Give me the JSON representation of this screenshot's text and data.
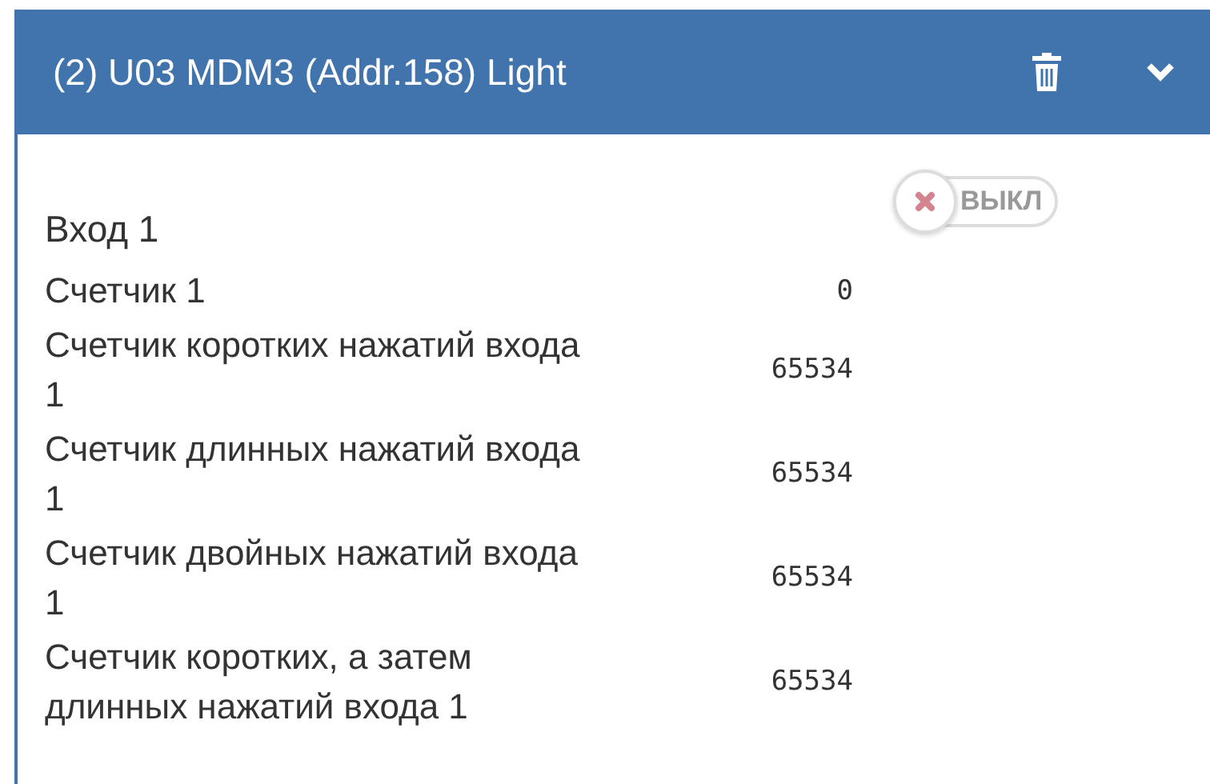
{
  "header": {
    "title": "(2) U03 MDM3 (Addr.158) Light"
  },
  "input": {
    "label": "Вход 1",
    "toggle": {
      "on": false,
      "label": "ВЫКЛ"
    }
  },
  "counters": [
    {
      "label": "Счетчик 1",
      "value": "0"
    },
    {
      "label": "Счетчик коротких нажатий входа 1",
      "value": "65534"
    },
    {
      "label": "Счетчик длинных нажатий входа 1",
      "value": "65534"
    },
    {
      "label": "Счетчик двойных нажатий входа 1",
      "value": "65534"
    },
    {
      "label": "Счетчик коротких, а затем длинных нажатий входа 1",
      "value": "65534"
    }
  ]
}
